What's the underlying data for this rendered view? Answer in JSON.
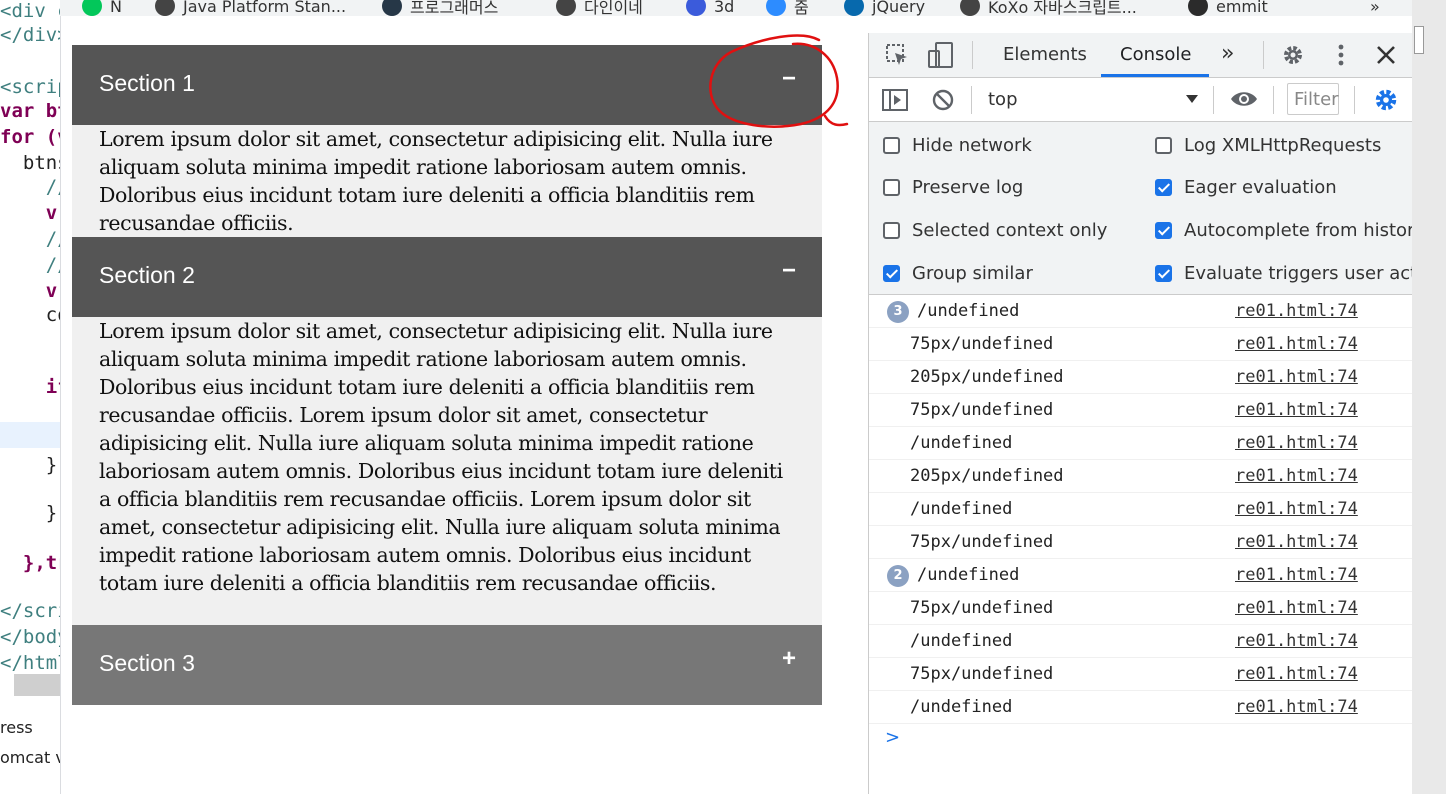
{
  "editor": {
    "lines": [
      {
        "text": "<div cl",
        "kind": "tag"
      },
      {
        "text": "</div>",
        "kind": "tag"
      },
      {
        "text": "<script",
        "kind": "tag"
      },
      {
        "text": "var btn",
        "kind": "kw"
      },
      {
        "text": "for (va",
        "kind": "kw"
      },
      {
        "text": "  btns",
        "kind": "plain"
      },
      {
        "text": "    //",
        "kind": "tag"
      },
      {
        "text": "    v",
        "kind": "kw"
      },
      {
        "text": "    //",
        "kind": "tag"
      },
      {
        "text": "    //",
        "kind": "tag"
      },
      {
        "text": "    v",
        "kind": "kw"
      },
      {
        "text": "    co",
        "kind": "plain"
      },
      {
        "text": "    if",
        "kind": "kw"
      },
      {
        "text": "    }",
        "kind": "plain"
      },
      {
        "text": "    }",
        "kind": "plain"
      },
      {
        "text": "  },tr",
        "kind": "kw"
      },
      {
        "text": "</scrip",
        "kind": "tag"
      },
      {
        "text": "</body",
        "kind": "tag"
      },
      {
        "text": "</html",
        "kind": "tag"
      }
    ],
    "bottom_items": [
      "ress",
      "omcat v"
    ]
  },
  "bookmarks": [
    {
      "label": "N",
      "icon": "naver-icon",
      "color": "#03c75a"
    },
    {
      "label": "Java Platform Stan...",
      "icon": "globe-icon",
      "color": "#444444"
    },
    {
      "label": "프로그래머스",
      "icon": "programmers-icon",
      "color": "#263747"
    },
    {
      "label": "다인이네",
      "icon": "more-vert-icon",
      "color": "#444444"
    },
    {
      "label": "3d",
      "icon": "kotlin-icon",
      "color": "#3b5bdb"
    },
    {
      "label": "줌",
      "icon": "zoom-icon",
      "color": "#2d8cff"
    },
    {
      "label": "jQuery",
      "icon": "jquery-icon",
      "color": "#0769ad"
    },
    {
      "label": "KoXo 자바스크립트...",
      "icon": "globe-icon",
      "color": "#444444"
    },
    {
      "label": "emmit",
      "icon": "emmet-icon",
      "color": "#2b2b2b"
    }
  ],
  "bookmarks_overflow": "»",
  "accordion": [
    {
      "title": "Section 1",
      "toggle": "−",
      "open": true,
      "color": "#555555",
      "body": "Lorem ipsum dolor sit amet, consectetur adipisicing elit. Nulla iure aliquam soluta minima impedit ratione laboriosam autem omnis. Doloribus eius incidunt totam iure deleniti a officia blanditiis rem recusandae officiis."
    },
    {
      "title": "Section 2",
      "toggle": "−",
      "open": true,
      "color": "#555555",
      "body": "Lorem ipsum dolor sit amet, consectetur adipisicing elit. Nulla iure aliquam soluta minima impedit ratione laboriosam autem omnis. Doloribus eius incidunt totam iure deleniti a officia blanditiis rem recusandae officiis. Lorem ipsum dolor sit amet, consectetur adipisicing elit. Nulla iure aliquam soluta minima impedit ratione laboriosam autem omnis. Doloribus eius incidunt totam iure deleniti a officia blanditiis rem recusandae officiis. Lorem ipsum dolor sit amet, consectetur adipisicing elit. Nulla iure aliquam soluta minima impedit ratione laboriosam autem omnis. Doloribus eius incidunt totam iure deleniti a officia blanditiis rem recusandae officiis."
    },
    {
      "title": "Section 3",
      "toggle": "+",
      "open": false,
      "color": "#777777",
      "body": ""
    }
  ],
  "annotation": {
    "shape": "hand-drawn red circle around Section 1 toggle",
    "color": "#e01010"
  },
  "devtools": {
    "tabs": {
      "elements": "Elements",
      "console": "Console",
      "more": "»"
    },
    "active_tab": "Console",
    "context": "top",
    "filter_placeholder": "Filter",
    "settings": [
      {
        "label": "Hide network",
        "checked": false
      },
      {
        "label": "Log XMLHttpRequests",
        "checked": false
      },
      {
        "label": "Preserve log",
        "checked": false
      },
      {
        "label": "Eager evaluation",
        "checked": true
      },
      {
        "label": "Selected context only",
        "checked": false
      },
      {
        "label": "Autocomplete from history",
        "checked": true
      },
      {
        "label": "Group similar",
        "checked": true
      },
      {
        "label": "Evaluate triggers user activation",
        "checked": true
      }
    ],
    "console_rows": [
      {
        "count": "3",
        "message": "/undefined",
        "source": "re01.html:74"
      },
      {
        "count": "",
        "message": "75px/undefined",
        "source": "re01.html:74"
      },
      {
        "count": "",
        "message": "205px/undefined",
        "source": "re01.html:74"
      },
      {
        "count": "",
        "message": "75px/undefined",
        "source": "re01.html:74"
      },
      {
        "count": "",
        "message": "/undefined",
        "source": "re01.html:74"
      },
      {
        "count": "",
        "message": "205px/undefined",
        "source": "re01.html:74"
      },
      {
        "count": "",
        "message": "/undefined",
        "source": "re01.html:74"
      },
      {
        "count": "",
        "message": "75px/undefined",
        "source": "re01.html:74"
      },
      {
        "count": "2",
        "message": "/undefined",
        "source": "re01.html:74"
      },
      {
        "count": "",
        "message": "75px/undefined",
        "source": "re01.html:74"
      },
      {
        "count": "",
        "message": "/undefined",
        "source": "re01.html:74"
      },
      {
        "count": "",
        "message": "75px/undefined",
        "source": "re01.html:74"
      },
      {
        "count": "",
        "message": "/undefined",
        "source": "re01.html:74"
      }
    ],
    "prompt_symbol": ">"
  }
}
